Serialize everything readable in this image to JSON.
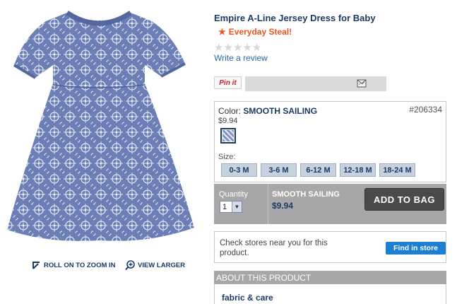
{
  "product": {
    "title": "Empire A-Line Jersey Dress for Baby",
    "badge_star": "★",
    "badge": "Everyday Steal!",
    "stars": "★★★★★",
    "review_link": "Write a review"
  },
  "zoom": {
    "roll_label": "ROLL ON TO ZOOM IN",
    "larger_label": "VIEW LARGER"
  },
  "share": {
    "pinit_label": "Pin it"
  },
  "options": {
    "color_prefix": "Color:",
    "color_name": "SMOOTH SAILING",
    "sku": "#206334",
    "price": "$9.94",
    "size_label": "Size:",
    "sizes": [
      "0-3 M",
      "3-6 M",
      "6-12 M",
      "12-18 M",
      "18-24 M"
    ]
  },
  "bag": {
    "quantity_label": "Quantity",
    "quantity_value": "1",
    "color_name": "SMOOTH SAILING",
    "price": "$9.94",
    "add_button": "ADD TO BAG"
  },
  "stores": {
    "text": "Check stores near you for this product.",
    "button": "Find in store"
  },
  "about": {
    "header": "ABOUT THIS PRODUCT",
    "fabric_link": "fabric & care"
  },
  "colors": {
    "title_navy": "#1b3b66",
    "accent_orange": "#f0541e",
    "link_blue": "#2a68b0",
    "button_blue": "#1d7fd1",
    "dress_blue": "#6d80b6"
  }
}
